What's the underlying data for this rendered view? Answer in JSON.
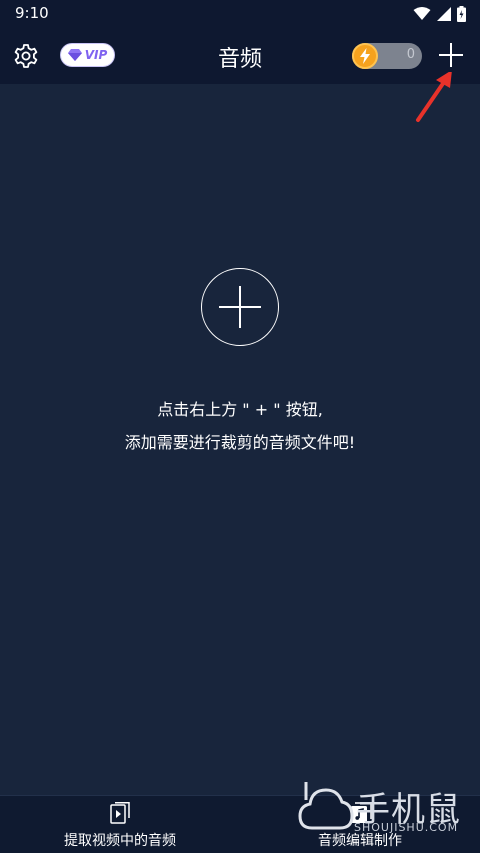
{
  "status_bar": {
    "time": "9:10"
  },
  "header": {
    "title": "音频",
    "vip_label": "VIP",
    "credit_count": "0"
  },
  "empty_state": {
    "line1": "点击右上方 \" + \" 按钮,",
    "line2": "添加需要进行裁剪的音频文件吧!"
  },
  "bottom_nav": {
    "items": [
      {
        "label": "提取视频中的音频",
        "icon": "video-play-icon"
      },
      {
        "label": "音频编辑制作",
        "icon": "audio-edit-icon"
      }
    ]
  },
  "watermark": {
    "text": "手机鼠",
    "sub": "SHOUJISHU.COM"
  },
  "colors": {
    "background": "#18253c",
    "app_bar": "#0e1830",
    "vip_purple": "#7f63f0",
    "coin_orange": "#f6a21e",
    "arrow_red": "#e8322a"
  }
}
